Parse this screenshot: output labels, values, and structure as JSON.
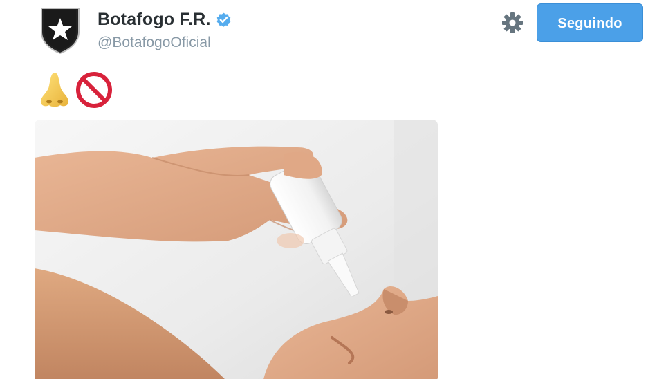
{
  "tweet": {
    "display_name": "Botafogo F.R.",
    "handle": "@BotafogoOficial",
    "follow_label": "Seguindo",
    "body_emojis": [
      "nose-emoji",
      "no-entry-sign-emoji"
    ]
  },
  "icons": {
    "verified": "verified-badge-icon",
    "settings": "gear-icon"
  },
  "colors": {
    "accent": "#4ba0e8",
    "verified": "#55acee",
    "name": "#292f33",
    "handle": "#8899a6"
  }
}
